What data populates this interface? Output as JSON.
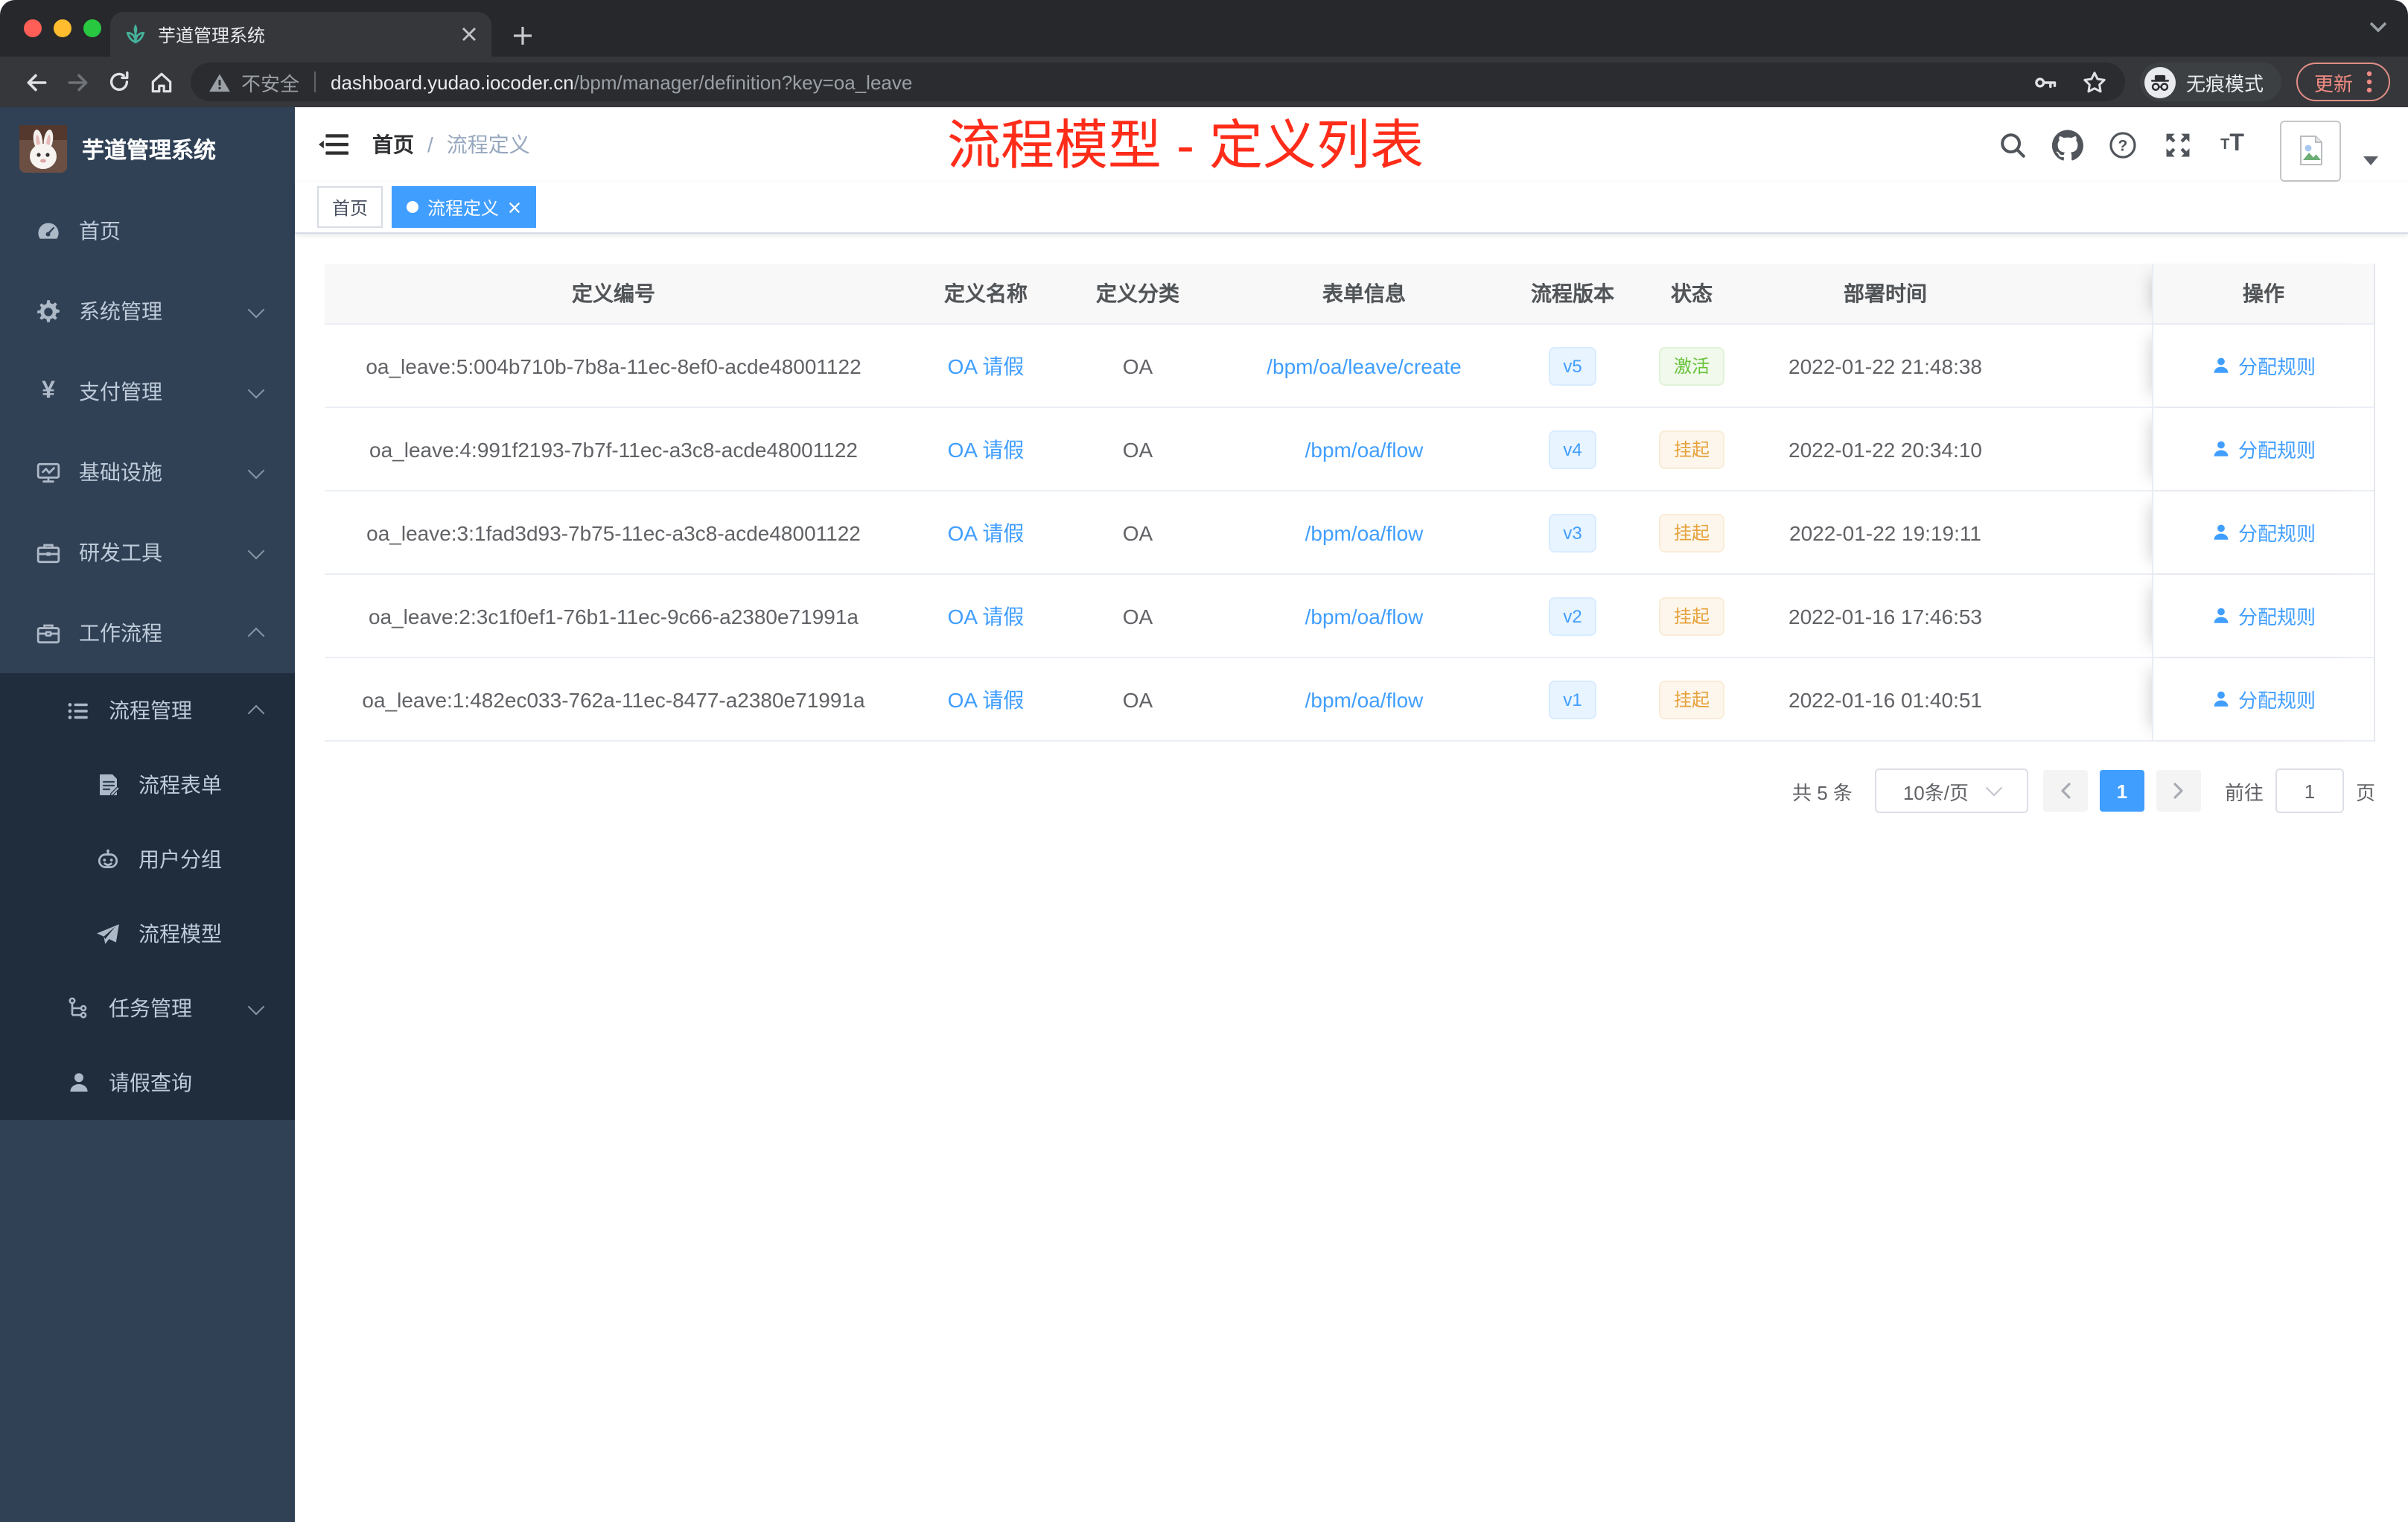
{
  "browser": {
    "tab_title": "芋道管理系统",
    "secure_label": "不安全",
    "url_host": "dashboard.yudao.iocoder.cn",
    "url_path": "/bpm/manager/definition?key=oa_leave",
    "incognito_label": "无痕模式",
    "update_label": "更新"
  },
  "sidebar": {
    "title": "芋道管理系统",
    "items": [
      {
        "label": "首页"
      },
      {
        "label": "系统管理"
      },
      {
        "label": "支付管理"
      },
      {
        "label": "基础设施"
      },
      {
        "label": "研发工具"
      },
      {
        "label": "工作流程"
      },
      {
        "label": "流程管理"
      },
      {
        "label": "流程表单"
      },
      {
        "label": "用户分组"
      },
      {
        "label": "流程模型"
      },
      {
        "label": "任务管理"
      },
      {
        "label": "请假查询"
      }
    ]
  },
  "header": {
    "breadcrumb_home": "首页",
    "breadcrumb_separator": "/",
    "breadcrumb_current": "流程定义",
    "annotation": "流程模型 - 定义列表"
  },
  "tags": {
    "home": "首页",
    "current": "流程定义"
  },
  "table": {
    "columns": [
      "定义编号",
      "定义名称",
      "定义分类",
      "表单信息",
      "流程版本",
      "状态",
      "部署时间",
      "操作"
    ],
    "rows": [
      {
        "id": "oa_leave:5:004b710b-7b8a-11ec-8ef0-acde48001122",
        "name": "OA 请假",
        "category": "OA",
        "form": "/bpm/oa/leave/create",
        "version": "v5",
        "status": "激活",
        "time": "2022-01-22 21:48:38",
        "action": "分配规则"
      },
      {
        "id": "oa_leave:4:991f2193-7b7f-11ec-a3c8-acde48001122",
        "name": "OA 请假",
        "category": "OA",
        "form": "/bpm/oa/flow",
        "version": "v4",
        "status": "挂起",
        "time": "2022-01-22 20:34:10",
        "action": "分配规则"
      },
      {
        "id": "oa_leave:3:1fad3d93-7b75-11ec-a3c8-acde48001122",
        "name": "OA 请假",
        "category": "OA",
        "form": "/bpm/oa/flow",
        "version": "v3",
        "status": "挂起",
        "time": "2022-01-22 19:19:11",
        "action": "分配规则"
      },
      {
        "id": "oa_leave:2:3c1f0ef1-76b1-11ec-9c66-a2380e71991a",
        "name": "OA 请假",
        "category": "OA",
        "form": "/bpm/oa/flow",
        "version": "v2",
        "status": "挂起",
        "time": "2022-01-16 17:46:53",
        "action": "分配规则"
      },
      {
        "id": "oa_leave:1:482ec033-762a-11ec-8477-a2380e71991a",
        "name": "OA 请假",
        "category": "OA",
        "form": "/bpm/oa/flow",
        "version": "v1",
        "status": "挂起",
        "time": "2022-01-16 01:40:51",
        "action": "分配规则"
      }
    ]
  },
  "pagination": {
    "total": "共 5 条",
    "page_size": "10条/页",
    "page": "1",
    "goto_label": "前往",
    "goto_value": "1",
    "page_unit": "页"
  },
  "colors": {
    "accent": "#409eff",
    "success": "#67c23a",
    "warning": "#e6a23c",
    "annotation_red": "#fe2c19",
    "sidebar_bg": "#304156",
    "submenu_bg": "#1f2d3d"
  }
}
